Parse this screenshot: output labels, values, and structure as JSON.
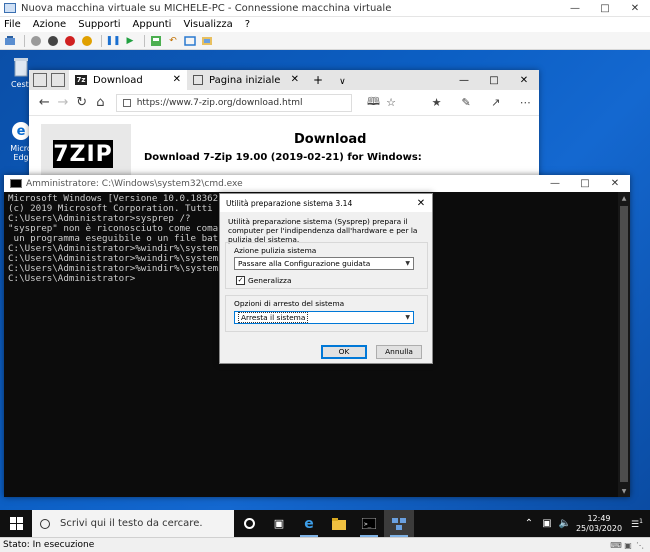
{
  "host": {
    "title": "Nuova macchina virtuale su MICHELE-PC - Connessione macchina virtuale",
    "menu": [
      "File",
      "Azione",
      "Supporti",
      "Appunti",
      "Visualizza",
      "?"
    ]
  },
  "desktop": {
    "icons": [
      {
        "label": "Cesti"
      },
      {
        "label": "Micro Edg"
      }
    ]
  },
  "edge": {
    "tabs": [
      {
        "label": "Download",
        "active": true
      },
      {
        "label": "Pagina iniziale",
        "active": false
      }
    ],
    "url": "https://www.7-zip.org/download.html",
    "page": {
      "logo_text": "7ZIP",
      "heading": "Download",
      "subheading": "Download 7-Zip 19.00 (2019-02-21) for Windows:"
    }
  },
  "cmd": {
    "title": "Amministratore: C:\\Windows\\system32\\cmd.exe",
    "lines": [
      "Microsoft Windows [Versione 10.0.18362.30",
      "(c) 2019 Microsoft Corporation. Tutti i d",
      "",
      "C:\\Users\\Administrator>sysprep /?",
      "\"sysprep\" non è riconosciuto come comando",
      " un programma eseguibile o un file batch.",
      "",
      "C:\\Users\\Administrator>%windir%\\system32\\",
      "",
      "C:\\Users\\Administrator>%windir%\\system32\\",
      "",
      "C:\\Users\\Administrator>%windir%\\system32\\",
      "",
      "C:\\Users\\Administrator>"
    ]
  },
  "sysprep": {
    "title": "Utilità preparazione sistema 3.14",
    "description": "Utilità preparazione sistema (Sysprep) prepara il computer per l'indipendenza dall'hardware e per la pulizia del sistema.",
    "cleanup_group_label": "Azione pulizia sistema",
    "cleanup_value": "Passare alla Configurazione guidata",
    "generalize_label": "Generalizza",
    "generalize_checked": true,
    "shutdown_group_label": "Opzioni di arresto del sistema",
    "shutdown_value": "Arresta il sistema",
    "ok_label": "OK",
    "cancel_label": "Annulla"
  },
  "taskbar": {
    "search_placeholder": "Scrivi qui il testo da cercare.",
    "time": "12:49",
    "date": "25/03/2020",
    "notification_count": "1"
  },
  "status": {
    "text": "Stato: In esecuzione"
  },
  "colors": {
    "desktop": "#0c5fc4",
    "accent": "#0078d7",
    "console_bg": "#0c0c0c",
    "console_fg": "#cccccc"
  }
}
